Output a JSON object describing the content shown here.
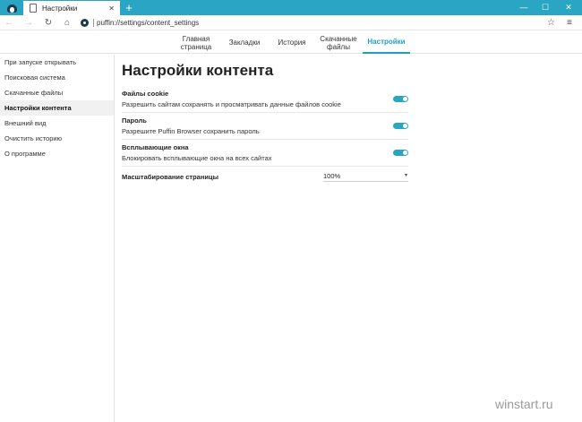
{
  "window": {
    "tab_title": "Настройки",
    "tab_close": "✕",
    "new_tab": "+",
    "min": "—",
    "max": "☐",
    "close": "✕"
  },
  "addressbar": {
    "back": "←",
    "forward": "→",
    "reload": "↻",
    "home": "⌂",
    "url": "puffin://settings/content_settings",
    "star": "☆",
    "menu": "≡"
  },
  "topnav": {
    "tabs": [
      {
        "label": "Главная страница"
      },
      {
        "label": "Закладки"
      },
      {
        "label": "История"
      },
      {
        "label": "Скачанные файлы"
      },
      {
        "label": "Настройки"
      }
    ],
    "active_index": 4
  },
  "sidebar": {
    "items": [
      {
        "label": "При запуске открывать"
      },
      {
        "label": "Поисковая система"
      },
      {
        "label": "Скачанные файлы"
      },
      {
        "label": "Настройки контента"
      },
      {
        "label": "Внешний вид"
      },
      {
        "label": "Очистить историю"
      },
      {
        "label": "О программе"
      }
    ],
    "active_index": 3
  },
  "main": {
    "title": "Настройки контента",
    "settings": [
      {
        "title": "Файлы cookie",
        "description": "Разрешить сайтам сохранять и просматривать данные файлов cookie",
        "enabled": true
      },
      {
        "title": "Пароль",
        "description": "Разрешите Puffin Browser сохранить пароль",
        "enabled": true
      },
      {
        "title": "Всплывающие окна",
        "description": "Блокировать всплывающие окна на всех сайтах",
        "enabled": true
      }
    ],
    "zoom": {
      "label": "Масштабирование страницы",
      "value": "100%",
      "caret": "▾"
    }
  },
  "watermark": "winstart.ru",
  "colors": {
    "accent": "#2aa6c4",
    "accent_text": "#1fa0c0"
  }
}
